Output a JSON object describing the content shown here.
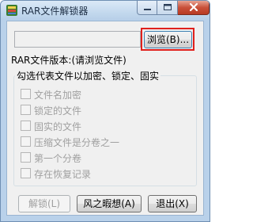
{
  "window": {
    "title": "RAR文件解锁器"
  },
  "controls": {
    "minimize_glyph": "▁",
    "maximize_glyph": "▢",
    "close_glyph": "✕"
  },
  "path": {
    "value": ""
  },
  "browse": {
    "label": "浏览(B)..."
  },
  "version": {
    "label": "RAR文件版本:(请浏览文件)"
  },
  "options": {
    "title": "勾选代表文件以加密、锁定、固实",
    "items": [
      {
        "label": "文件名加密",
        "checked": false,
        "enabled": false
      },
      {
        "label": "锁定的文件",
        "checked": false,
        "enabled": false
      },
      {
        "label": "固实的文件",
        "checked": false,
        "enabled": false
      },
      {
        "label": "压缩文件是分卷之一",
        "checked": false,
        "enabled": false
      },
      {
        "label": "第一个分卷",
        "checked": false,
        "enabled": false
      },
      {
        "label": "存在恢复记录",
        "checked": false,
        "enabled": false
      }
    ]
  },
  "buttons": {
    "unlock": "解锁(L)",
    "mode": "风之暇想(A)",
    "exit": "退出(X)"
  },
  "colors": {
    "highlight": "#e0201c",
    "close_button": "#c9503a",
    "frame": "#b9d1ea"
  }
}
